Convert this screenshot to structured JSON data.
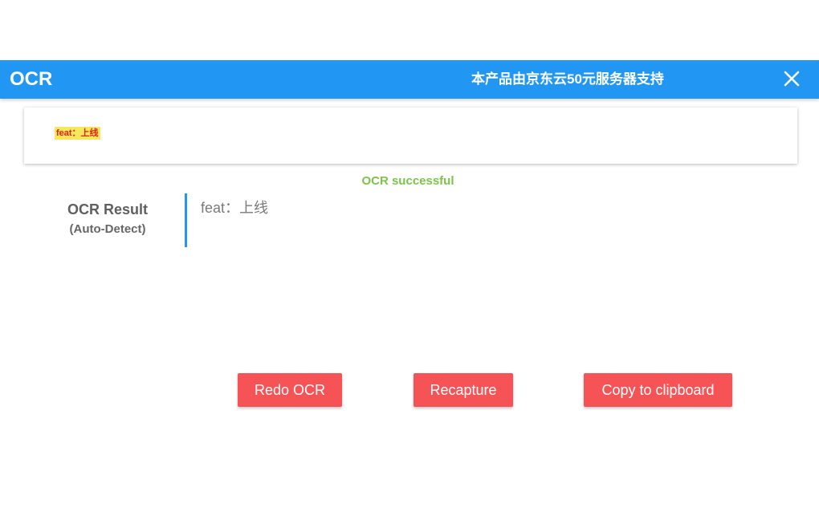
{
  "header": {
    "title": "OCR",
    "sponsor_text": "本产品由京东云50元服务器支持",
    "close_icon": "close-icon",
    "background_color": "#2196f3"
  },
  "preview": {
    "captured_text": "feat：上线"
  },
  "status": {
    "message": "OCR successful",
    "color": "#7dc24a"
  },
  "result": {
    "label": "OCR Result",
    "mode": "(Auto-Detect)",
    "text": "feat：上线"
  },
  "actions": {
    "redo_label": "Redo OCR",
    "recapture_label": "Recapture",
    "copy_label": "Copy to clipboard",
    "button_color": "#f65356"
  }
}
